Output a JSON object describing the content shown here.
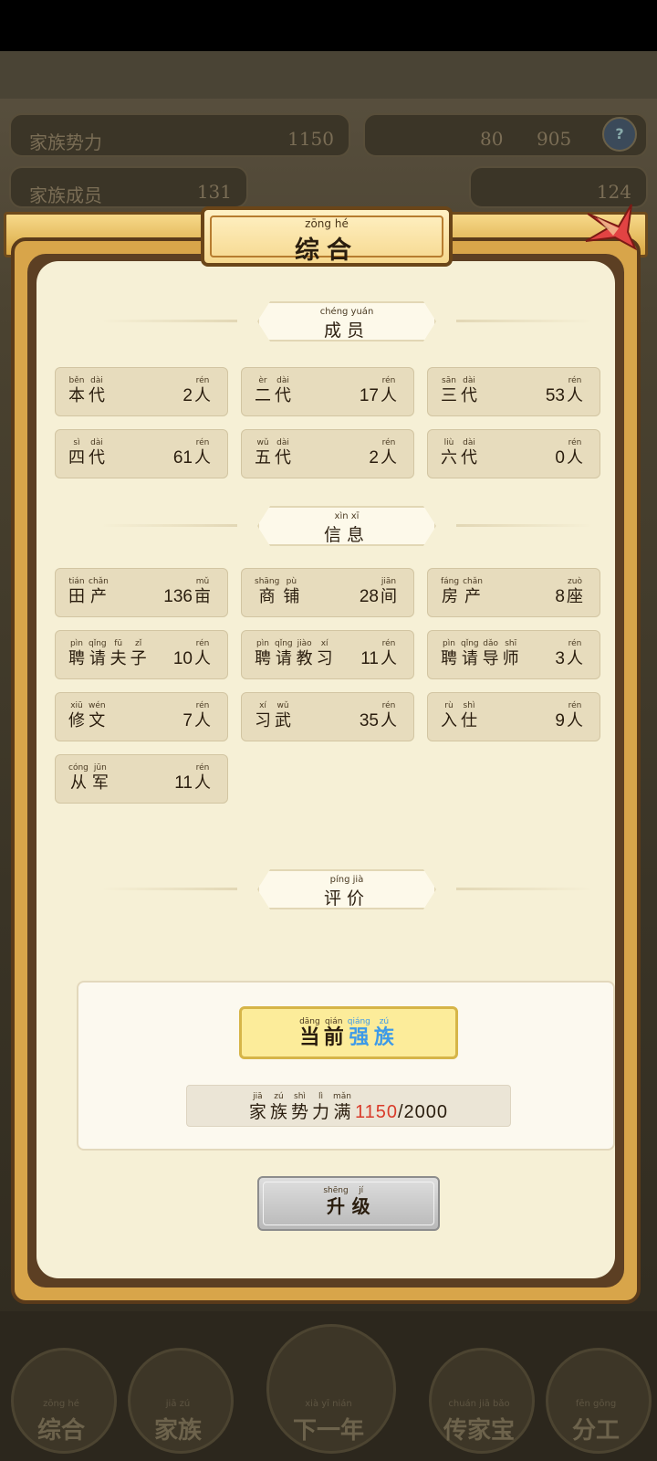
{
  "background": {
    "power_label": "家族势力",
    "power_value": "1150",
    "members_label": "家族成员",
    "members_value": "131",
    "currency_a": "80",
    "currency_b": "905",
    "gold": "124",
    "help_icon": "?",
    "nav": [
      {
        "py": "zōng hé",
        "label": "综合"
      },
      {
        "py": "jiā zú",
        "label": "家族"
      },
      {
        "py": "xià yī nián",
        "label": "下一年"
      },
      {
        "py": "chuán jiā bǎo",
        "label": "传家宝"
      },
      {
        "py": "fēn gōng",
        "label": "分工"
      }
    ]
  },
  "modal": {
    "title_py": "zōng   hé",
    "title": "综合",
    "sections": {
      "members": {
        "py": "chéng yuán",
        "label": "成员"
      },
      "info": {
        "py": "xìn  xī",
        "label": "信息"
      },
      "rating": {
        "py": "píng  jià",
        "label": "评价"
      }
    },
    "members": [
      {
        "chars": [
          [
            "běn",
            "本"
          ],
          [
            "dài",
            "代"
          ]
        ],
        "value": "2",
        "unit": [
          "rén",
          "人"
        ]
      },
      {
        "chars": [
          [
            "èr",
            "二"
          ],
          [
            "dài",
            "代"
          ]
        ],
        "value": "17",
        "unit": [
          "rén",
          "人"
        ]
      },
      {
        "chars": [
          [
            "sān",
            "三"
          ],
          [
            "dài",
            "代"
          ]
        ],
        "value": "53",
        "unit": [
          "rén",
          "人"
        ]
      },
      {
        "chars": [
          [
            "sì",
            "四"
          ],
          [
            "dài",
            "代"
          ]
        ],
        "value": "61",
        "unit": [
          "rén",
          "人"
        ]
      },
      {
        "chars": [
          [
            "wǔ",
            "五"
          ],
          [
            "dài",
            "代"
          ]
        ],
        "value": "2",
        "unit": [
          "rén",
          "人"
        ]
      },
      {
        "chars": [
          [
            "liù",
            "六"
          ],
          [
            "dài",
            "代"
          ]
        ],
        "value": "0",
        "unit": [
          "rén",
          "人"
        ]
      }
    ],
    "info": [
      {
        "chars": [
          [
            "tián",
            "田"
          ],
          [
            "chǎn",
            "产"
          ]
        ],
        "value": "136",
        "unit": [
          "mǔ",
          "亩"
        ]
      },
      {
        "chars": [
          [
            "shāng",
            "商"
          ],
          [
            "pù",
            "铺"
          ]
        ],
        "value": "28",
        "unit": [
          "jiān",
          "间"
        ]
      },
      {
        "chars": [
          [
            "fáng",
            "房"
          ],
          [
            "chǎn",
            "产"
          ]
        ],
        "value": "8",
        "unit": [
          "zuò",
          "座"
        ]
      },
      {
        "chars": [
          [
            "pìn",
            "聘"
          ],
          [
            "qǐng",
            "请"
          ],
          [
            "fū",
            "夫"
          ],
          [
            "zǐ",
            "子"
          ]
        ],
        "value": "10",
        "unit": [
          "rén",
          "人"
        ]
      },
      {
        "chars": [
          [
            "pìn",
            "聘"
          ],
          [
            "qǐng",
            "请"
          ],
          [
            "jiào",
            "教"
          ],
          [
            "xí",
            "习"
          ]
        ],
        "value": "11",
        "unit": [
          "rén",
          "人"
        ]
      },
      {
        "chars": [
          [
            "pìn",
            "聘"
          ],
          [
            "qǐng",
            "请"
          ],
          [
            "dǎo",
            "导"
          ],
          [
            "shī",
            "师"
          ]
        ],
        "value": "3",
        "unit": [
          "rén",
          "人"
        ]
      },
      {
        "chars": [
          [
            "xiū",
            "修"
          ],
          [
            "wén",
            "文"
          ]
        ],
        "value": "7",
        "unit": [
          "rén",
          "人"
        ]
      },
      {
        "chars": [
          [
            "xí",
            "习"
          ],
          [
            "wǔ",
            "武"
          ]
        ],
        "value": "35",
        "unit": [
          "rén",
          "人"
        ]
      },
      {
        "chars": [
          [
            "rù",
            "入"
          ],
          [
            "shì",
            "仕"
          ]
        ],
        "value": "9",
        "unit": [
          "rén",
          "人"
        ]
      },
      {
        "chars": [
          [
            "cóng",
            "从"
          ],
          [
            "jūn",
            "军"
          ]
        ],
        "value": "11",
        "unit": [
          "rén",
          "人"
        ]
      }
    ],
    "rating_current": [
      [
        "dāng",
        "当"
      ],
      [
        "qián",
        "前"
      ],
      [
        "qiáng",
        "强"
      ],
      [
        "zú",
        "族"
      ]
    ],
    "rating_power_chars": [
      [
        "jiā",
        "家"
      ],
      [
        "zú",
        "族"
      ],
      [
        "shì",
        "势"
      ],
      [
        "lì",
        "力"
      ],
      [
        "mǎn",
        "满"
      ]
    ],
    "rating_power_current": "1150",
    "rating_power_max": "/2000",
    "upgrade": [
      [
        "shēng",
        "升"
      ],
      [
        "jí",
        "级"
      ]
    ],
    "colors": {
      "accent_blue": "#3d9ae8",
      "accent_red": "#d93b2a",
      "gold": "#d8a54a"
    }
  }
}
